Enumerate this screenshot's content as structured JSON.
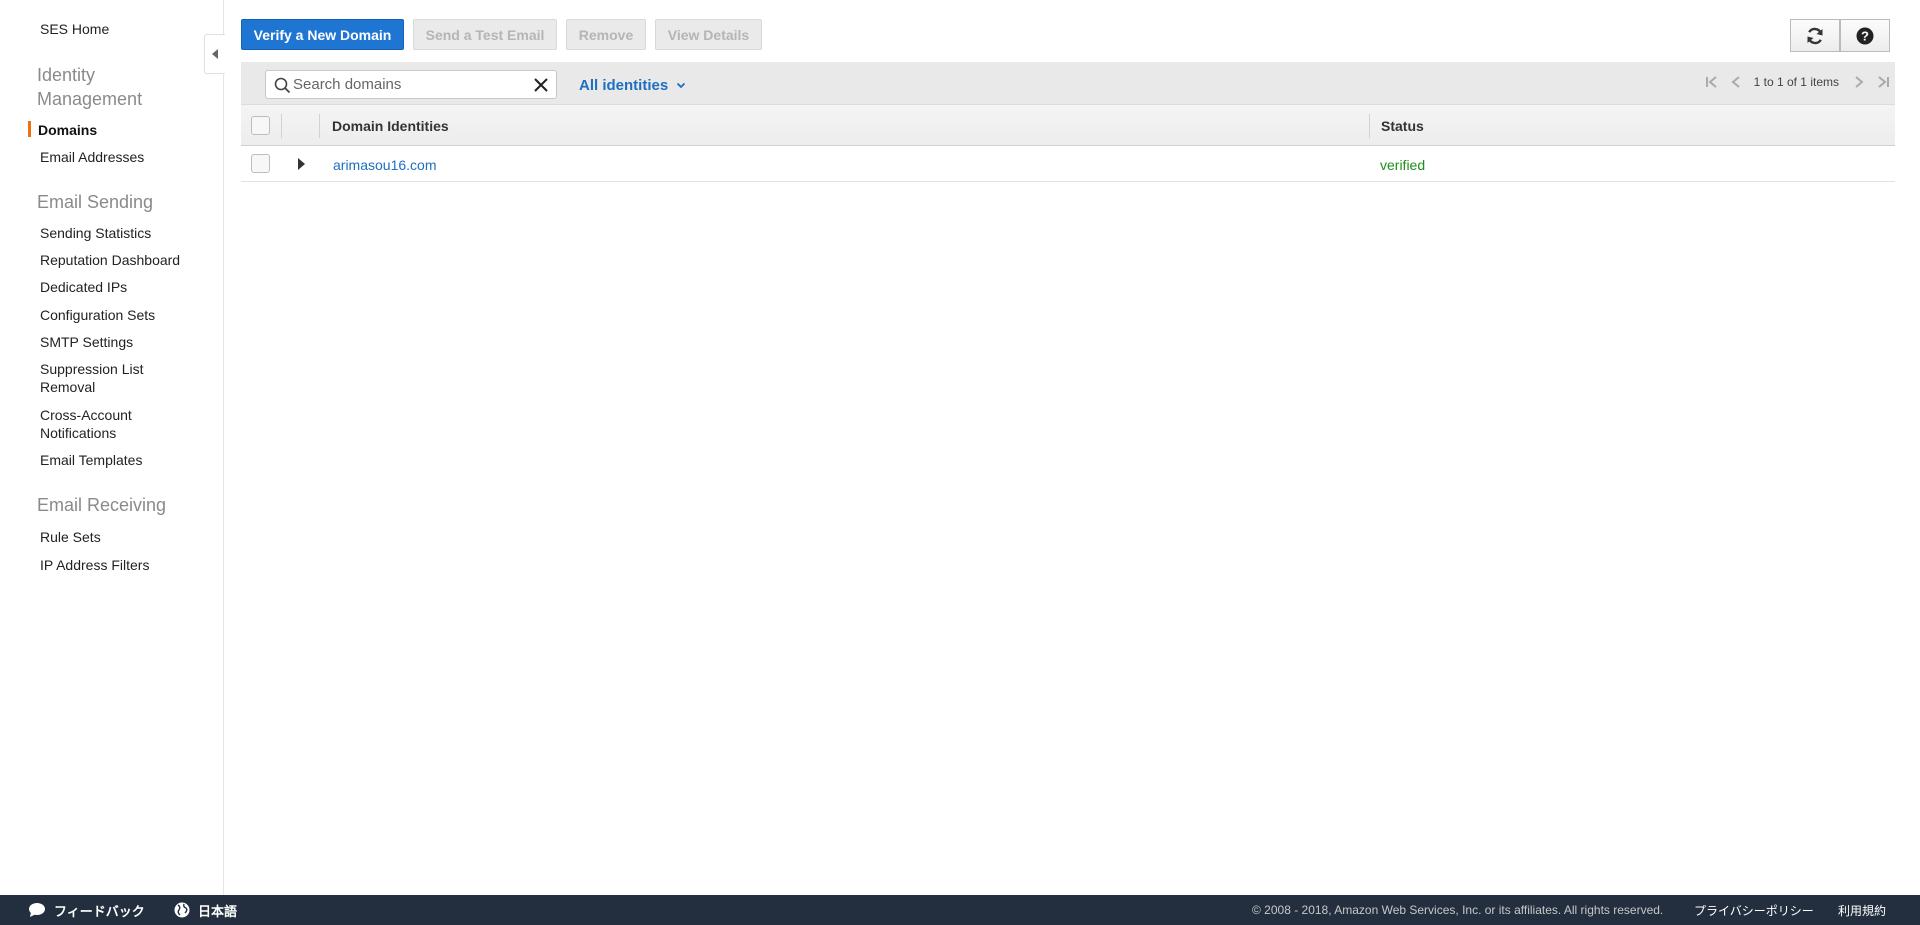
{
  "sidebar": {
    "home": "SES Home",
    "sections": [
      {
        "title": "Identity Management",
        "items": [
          "Domains",
          "Email Addresses"
        ]
      },
      {
        "title": "Email Sending",
        "items": [
          "Sending Statistics",
          "Reputation Dashboard",
          "Dedicated IPs",
          "Configuration Sets",
          "SMTP Settings",
          "Suppression List Removal",
          "Cross-Account Notifications",
          "Email Templates"
        ]
      },
      {
        "title": "Email Receiving",
        "items": [
          "Rule Sets",
          "IP Address Filters"
        ]
      }
    ],
    "active_item": "Domains",
    "accent_color": "#ec7211"
  },
  "toolbar": {
    "verify_label": "Verify a New Domain",
    "test_email_label": "Send a Test Email",
    "remove_label": "Remove",
    "view_details_label": "View Details",
    "refresh_icon": "refresh-icon",
    "help_icon": "help-icon",
    "primary_color": "#1e76d2"
  },
  "filter": {
    "search_placeholder": "Search domains",
    "search_value": "",
    "dropdown_label": "All identities"
  },
  "pager": {
    "text": "1 to 1 of 1 items"
  },
  "table": {
    "headers": [
      "Domain Identities",
      "Status"
    ],
    "rows": [
      {
        "domain": "arimasou16.com",
        "status": "verified"
      }
    ],
    "status_color": "#1d8f1d"
  },
  "footer": {
    "feedback": "フィードバック",
    "language": "日本語",
    "copyright": "© 2008 - 2018, Amazon Web Services, Inc. or its affiliates. All rights reserved.",
    "privacy": "プライバシーポリシー",
    "terms": "利用規約",
    "background": "#232f3e"
  }
}
